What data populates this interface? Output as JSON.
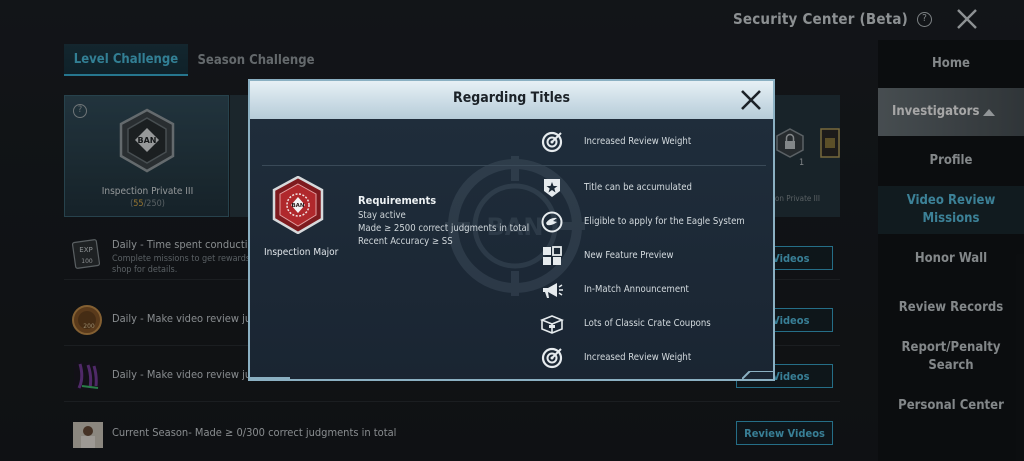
{
  "header": {
    "title": "Security Center (Beta)",
    "help_icon": "?"
  },
  "sidebar": {
    "items": [
      {
        "label": "Home"
      },
      {
        "label": "Investigators"
      },
      {
        "label": "Profile"
      },
      {
        "label": "Video Review Missions"
      },
      {
        "label": "Honor Wall"
      },
      {
        "label": "Review Records"
      },
      {
        "label": "Report/Penalty Search"
      },
      {
        "label": "Personal Center"
      }
    ]
  },
  "tabs": [
    {
      "label": "Level Challenge"
    },
    {
      "label": "Season Challenge"
    }
  ],
  "level_card": {
    "help_icon": "?",
    "badge_text": "BAN",
    "name": "Inspection Private III",
    "progress_current": "55",
    "progress_total": "/250"
  },
  "right_card": {
    "label": "on Private III",
    "count": "1"
  },
  "missions": [
    {
      "icon_text": "EXP 100",
      "title": "Daily - Time spent conducting E",
      "subtitle": "Complete missions to get rewards a",
      "subtitle2": "shop for details.",
      "button": "w Videos"
    },
    {
      "icon_text": "200",
      "title": "Daily - Make video review judgm",
      "button": "w Videos"
    },
    {
      "icon_text": "",
      "title": "Daily - Make video review judgm",
      "button": "w Videos"
    },
    {
      "icon_text": "",
      "title": "Current Season- Made  ≥ 0/300 correct judgments in total",
      "button": "Review Videos"
    }
  ],
  "modal": {
    "title": "Regarding Titles",
    "top_perk": "Increased Review Weight",
    "title_name": "Inspection Major",
    "badge_text": "BAN",
    "watermark_text": "BAN",
    "requirements_heading": "Requirements",
    "requirements": [
      "Stay active",
      "Made  ≥ 2500 correct judgments in total",
      "Recent Accuracy ≥ SS"
    ],
    "perks": [
      {
        "icon": "star-shield-icon",
        "label": "Title can be accumulated"
      },
      {
        "icon": "eagle-icon",
        "label": "Eligible to apply for the Eagle System"
      },
      {
        "icon": "new-feature-icon",
        "label": "New Feature Preview"
      },
      {
        "icon": "megaphone-icon",
        "label": "In-Match Announcement"
      },
      {
        "icon": "crate-icon",
        "label": "Lots of Classic Crate Coupons"
      },
      {
        "icon": "target-icon",
        "label": "Increased Review Weight"
      }
    ]
  },
  "colors": {
    "accent": "#3bb6db",
    "modal_border": "#8bb0c2",
    "gold": "#e8b44a",
    "badge_red": "#b0282c"
  }
}
